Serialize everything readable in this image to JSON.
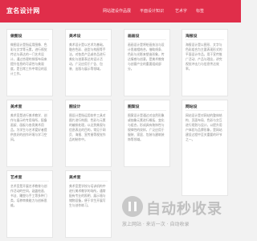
{
  "site": {
    "logo": "宜名设计网"
  },
  "nav": {
    "items": [
      "网站建设作品展",
      "平面设计知识",
      "艺术字",
      "标签"
    ]
  },
  "cards": [
    {
      "title": "做图设",
      "text": "做图设计是指运用图像、色彩与文字等元素，进行视觉传达与表达的一门艺术设计，通过合理的排版布局来提升信息的可读性与美观度，是日常工作中常见的设计工作。"
    },
    {
      "title": "美术设",
      "text": "美术设计是以艺术为基础，融合色彩、造型与构图等手法，对各类产品或作品进行美化与创意表达的设计活动，广泛应用于广告、包装、出版与展示等领域。"
    },
    {
      "title": "画画设",
      "text": "画画设计是将绘画技法与设计思维相结合，借助线条、色彩与光影来塑造形象，传达情感与创意，是美术教育与创意产业的重要组成部分。"
    },
    {
      "title": "海报设",
      "text": "海报设计是以图形、文字与色彩组合为主要表现形式的平面设计作品，用于宣传推广活动、产品与理念，讲究视觉冲击力与信息传达效率。"
    },
    {
      "title": "美术室",
      "text": "美术室是进行美术教学、创作与展示的专用场所，配备画架、画板与各类美术用品，为学生与艺术爱好者提供良好的创作环境与学习空间。"
    },
    {
      "title": "图设计",
      "text": "图设计是指运用软件工具对图片进行构图、色彩与元素的编排处理，以达到美观与信息表达的目的，常见于网页、海报、宣传册等视觉作品的制作中。"
    },
    {
      "title": "图案设",
      "text": "图案设计是通过对自然形象或抽象元素进行概括、变化与组合，形成具有装饰性与规律性的纹样，广泛应用于服装、家居、包装与建筑装饰等领域。"
    },
    {
      "title": "网站设",
      "text": "网站设计是对网站的整体结构、页面布局、色彩与交互进行规划与设计，以提升用户体验与品牌形象，是网站建设过程中至关重要的环节之一。"
    },
    {
      "title": "艺术室",
      "text": "艺术室是开展艺术教育与创作活动的空间，涵盖绘画、书法、雕塑与手工等多种门类，培养审美能力与创新思维。"
    },
    {
      "title": "美术室",
      "text": "美术室是学校与培训机构中进行美术教学的场所，通常配有专业的照明、展示墙与储物设备，便于学生开展写生与创作练习。"
    }
  ],
  "watermark": {
    "text": "自动秒收录",
    "sub": "放上网站 · 来访一次 · 自动收录"
  }
}
